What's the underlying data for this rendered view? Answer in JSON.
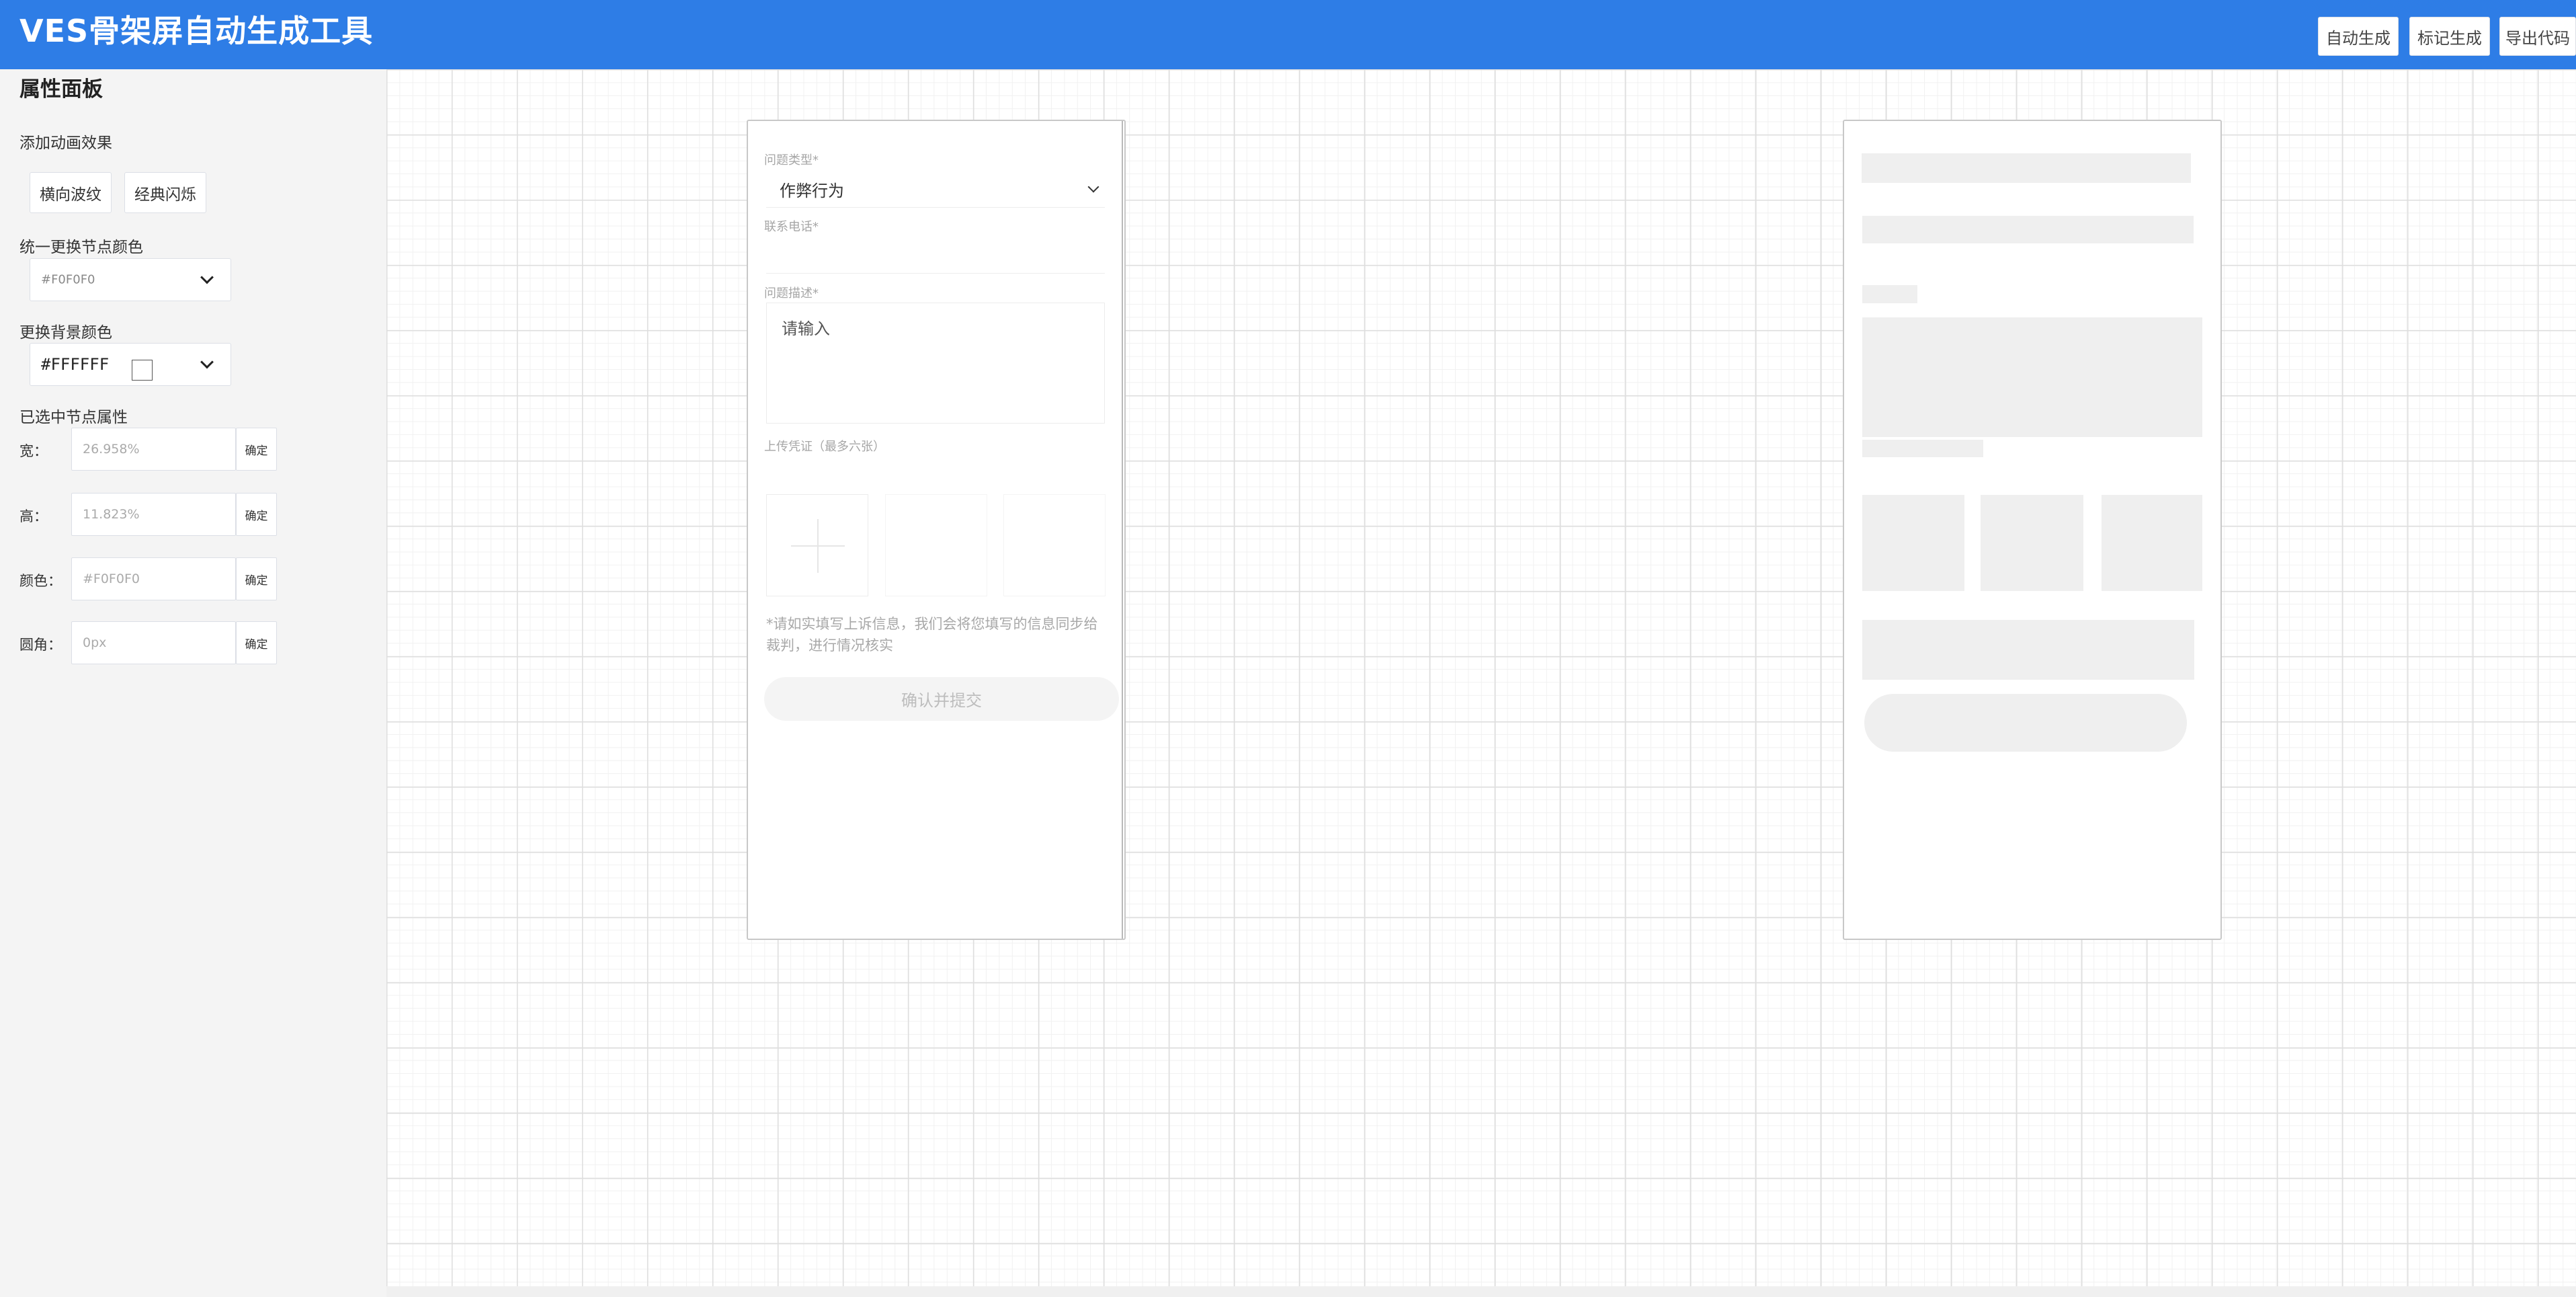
{
  "header": {
    "title": "VES骨架屏自动生成工具",
    "buttons": [
      "自动生成",
      "标记生成",
      "导出代码"
    ]
  },
  "panel": {
    "title": "属性面板",
    "animation": {
      "label": "添加动画效果",
      "buttons": [
        "横向波纹",
        "经典闪烁"
      ]
    },
    "node_color": {
      "label": "统一更换节点颜色",
      "value": "#F0F0F0"
    },
    "bg_color": {
      "label": "更换背景颜色",
      "value": "#FFFFFF"
    },
    "selected": {
      "label": "已选中节点属性",
      "rows": [
        {
          "label": "宽：",
          "value": "26.958%",
          "confirm": "确定"
        },
        {
          "label": "高：",
          "value": "11.823%",
          "confirm": "确定"
        },
        {
          "label": "颜色：",
          "value": "#F0F0F0",
          "confirm": "确定"
        },
        {
          "label": "圆角：",
          "value": "0px",
          "confirm": "确定"
        }
      ]
    }
  },
  "form": {
    "type_label": "问题类型*",
    "type_value": "作弊行为",
    "phone_label": "联系电话*",
    "desc_label": "问题描述*",
    "desc_placeholder": "请输入",
    "upload_label": "上传凭证（最多六张）",
    "note": "*请如实填写上诉信息，我们会将您填写的信息同步给裁判，进行情况核实",
    "submit": "确认并提交"
  },
  "colors": {
    "header": "#2E7DE6",
    "skeleton": "#F0F0F0",
    "panel_bg": "#F4F4F4"
  }
}
